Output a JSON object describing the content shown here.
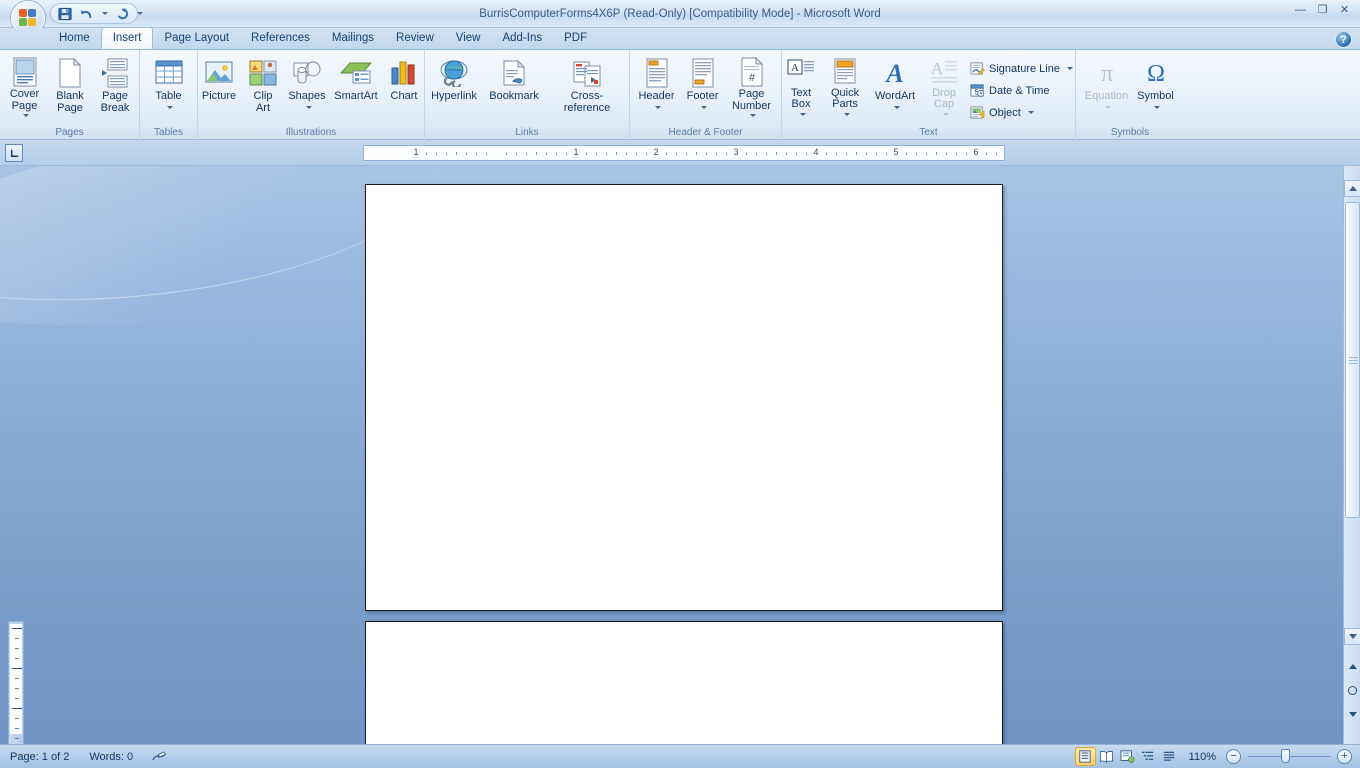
{
  "window": {
    "title": "BurrisComputerForms4X6P (Read-Only) [Compatibility Mode] - Microsoft Word",
    "minimize": "—",
    "restore": "❐",
    "close": "✕",
    "help": "?"
  },
  "quick_access": {
    "save": "save-icon",
    "undo": "undo-icon",
    "redo": "redo-icon",
    "customize": "customize-icon"
  },
  "tabs": [
    {
      "label": "Home",
      "active": false
    },
    {
      "label": "Insert",
      "active": true
    },
    {
      "label": "Page Layout",
      "active": false
    },
    {
      "label": "References",
      "active": false
    },
    {
      "label": "Mailings",
      "active": false
    },
    {
      "label": "Review",
      "active": false
    },
    {
      "label": "View",
      "active": false
    },
    {
      "label": "Add-Ins",
      "active": false
    },
    {
      "label": "PDF",
      "active": false
    }
  ],
  "ribbon": {
    "groups": [
      {
        "name": "Pages",
        "label": "Pages",
        "items": [
          {
            "label": "Cover\nPage",
            "dropdown": true,
            "disabled": false
          },
          {
            "label": "Blank\nPage",
            "dropdown": false,
            "disabled": false
          },
          {
            "label": "Page\nBreak",
            "dropdown": false,
            "disabled": false
          }
        ]
      },
      {
        "name": "Tables",
        "label": "Tables",
        "items": [
          {
            "label": "Table",
            "dropdown": true,
            "disabled": false
          }
        ]
      },
      {
        "name": "Illustrations",
        "label": "Illustrations",
        "items": [
          {
            "label": "Picture",
            "dropdown": false,
            "disabled": false
          },
          {
            "label": "Clip\nArt",
            "dropdown": false,
            "disabled": false
          },
          {
            "label": "Shapes",
            "dropdown": true,
            "disabled": false
          },
          {
            "label": "SmartArt",
            "dropdown": false,
            "disabled": false
          },
          {
            "label": "Chart",
            "dropdown": false,
            "disabled": false
          }
        ]
      },
      {
        "name": "Links",
        "label": "Links",
        "items": [
          {
            "label": "Hyperlink",
            "dropdown": false,
            "disabled": false
          },
          {
            "label": "Bookmark",
            "dropdown": false,
            "disabled": false
          },
          {
            "label": "Cross-reference",
            "dropdown": false,
            "disabled": false
          }
        ]
      },
      {
        "name": "Header & Footer",
        "label": "Header & Footer",
        "items": [
          {
            "label": "Header",
            "dropdown": true,
            "disabled": false
          },
          {
            "label": "Footer",
            "dropdown": true,
            "disabled": false
          },
          {
            "label": "Page\nNumber",
            "dropdown": true,
            "disabled": false
          }
        ]
      },
      {
        "name": "Text",
        "label": "Text",
        "items": [
          {
            "label": "Text\nBox",
            "dropdown": true,
            "disabled": false
          },
          {
            "label": "Quick\nParts",
            "dropdown": true,
            "disabled": false
          },
          {
            "label": "WordArt",
            "dropdown": true,
            "disabled": false
          },
          {
            "label": "Drop\nCap",
            "dropdown": true,
            "disabled": true
          }
        ],
        "small_items": [
          {
            "label": "Signature Line",
            "dropdown": true
          },
          {
            "label": "Date & Time",
            "dropdown": false
          },
          {
            "label": "Object",
            "dropdown": true
          }
        ]
      },
      {
        "name": "Symbols",
        "label": "Symbols",
        "items": [
          {
            "label": "Equation",
            "dropdown": true,
            "disabled": true
          },
          {
            "label": "Symbol",
            "dropdown": true,
            "disabled": false
          }
        ]
      }
    ]
  },
  "ruler": {
    "tab_selector": "left-tab-icon",
    "numbers": [
      "1",
      "1",
      "2",
      "3",
      "4"
    ]
  },
  "document": {
    "page1_text": "",
    "page2_text": ""
  },
  "status": {
    "page": "Page: 1 of 2",
    "words": "Words: 0",
    "proofing": "proofing-icon",
    "zoom": "110%",
    "zoom_out": "−",
    "zoom_in": "+",
    "views": [
      {
        "name": "print-layout",
        "active": true
      },
      {
        "name": "full-screen-reading",
        "active": false
      },
      {
        "name": "web-layout",
        "active": false
      },
      {
        "name": "outline",
        "active": false
      },
      {
        "name": "draft",
        "active": false
      }
    ]
  },
  "colors": {
    "accent": "#1b3a6b",
    "ribbon_bg": "#eaf2fa",
    "doc_bg": "#8fb0d8",
    "tab_active": "#fdfefe"
  }
}
